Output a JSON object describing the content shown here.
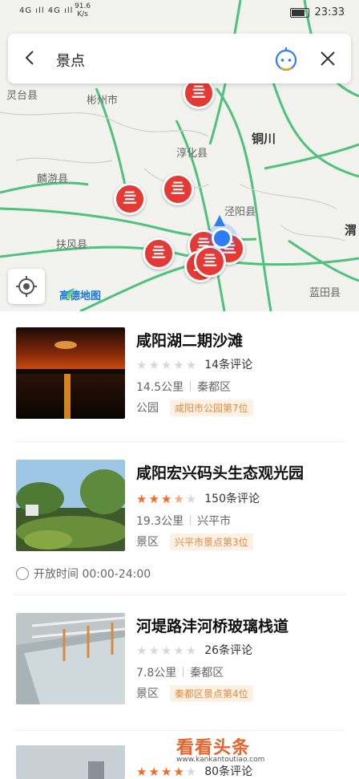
{
  "status": {
    "signal": "4G ıll 4G ıll",
    "net_speed": "91.6",
    "net_unit": "K/s",
    "battery": "",
    "time": "23:33"
  },
  "search": {
    "query": "景点"
  },
  "map": {
    "labels": {
      "tongchuan": "铜川",
      "chunhua": "淳化县",
      "linyou": "麟游县",
      "fufeng": "扶风县",
      "jingyang": "泾阳县",
      "lingtai": "灵台县",
      "binzhou": "彬州市",
      "lantian": "蓝田县",
      "wei": "渭"
    },
    "brand": "高德地图"
  },
  "results": [
    {
      "title": "咸阳湖二期沙滩",
      "stars": 0,
      "reviews": "14条评论",
      "distance": "14.5公里",
      "district": "秦都区",
      "category": "公园",
      "rank": "咸阳市公园第7位"
    },
    {
      "title": "咸阳宏兴码头生态观光园",
      "stars": 3.5,
      "reviews": "150条评论",
      "distance": "19.3公里",
      "district": "兴平市",
      "category": "景区",
      "rank": "兴平市景点第3位",
      "hours": "开放时间 00:00-24:00"
    },
    {
      "title": "河堤路沣河桥玻璃栈道",
      "stars": 0,
      "reviews": "26条评论",
      "distance": "7.8公里",
      "district": "秦都区",
      "category": "景区",
      "rank": "秦都区景点第4位"
    },
    {
      "reviews": "80条评论"
    }
  ],
  "watermark": {
    "main": "看看头条",
    "url": "www.kankantoutiao.com"
  }
}
